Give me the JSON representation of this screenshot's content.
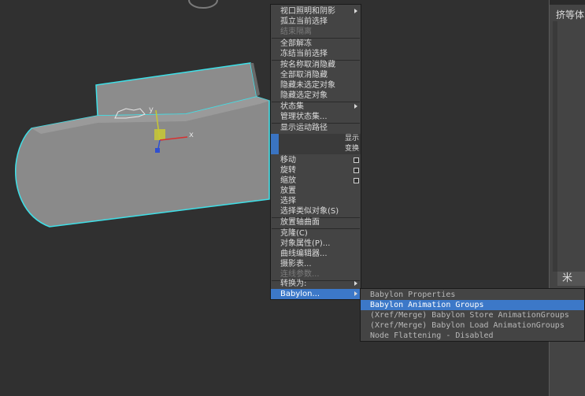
{
  "quad_menu": {
    "items": [
      {
        "label": "视口照明和阴影",
        "arrow": true
      },
      {
        "label": "孤立当前选择"
      },
      {
        "label": "结束隔离",
        "dim": true
      },
      {
        "label": "全部解冻"
      },
      {
        "label": "冻结当前选择"
      },
      {
        "label": "按名称取消隐藏"
      },
      {
        "label": "全部取消隐藏"
      },
      {
        "label": "隐藏未选定对象"
      },
      {
        "label": "隐藏选定对象"
      },
      {
        "label": "状态集",
        "arrow": true
      },
      {
        "label": "管理状态集..."
      },
      {
        "label": "显示运动路径"
      },
      {
        "label": "移动",
        "box": true
      },
      {
        "label": "旋转",
        "box": true
      },
      {
        "label": "缩放",
        "box": true
      },
      {
        "label": "放置"
      },
      {
        "label": "选择"
      },
      {
        "label": "选择类似对象(S)"
      },
      {
        "label": "放置轴曲面"
      },
      {
        "label": "克隆(C)"
      },
      {
        "label": "对象属性(P)..."
      },
      {
        "label": "曲线编辑器..."
      },
      {
        "label": "摄影表..."
      },
      {
        "label": "连线参数...",
        "dim": true
      },
      {
        "label": "转换为:",
        "arrow": true
      },
      {
        "label": "Babylon...",
        "arrow": true,
        "selected": true
      }
    ],
    "display_header": "显示",
    "transform_header": "变换"
  },
  "submenu": {
    "items": [
      {
        "label": "Babylon Properties"
      },
      {
        "label": "Babylon Animation Groups",
        "selected": true
      },
      {
        "label": "(Xref/Merge) Babylon Store AnimationGroups"
      },
      {
        "label": "(Xref/Merge) Babylon Load AnimationGroups"
      },
      {
        "label": "Node Flattening - Disabled"
      }
    ]
  },
  "side_panel": {
    "label": "挤等体(",
    "cross_label": "米"
  },
  "gizmo": {
    "x_label": "x",
    "y_label": "y"
  },
  "colors": {
    "highlight": "#3c78c8",
    "selection_outline": "#3ee0e8",
    "object": "#8a8a8a"
  }
}
